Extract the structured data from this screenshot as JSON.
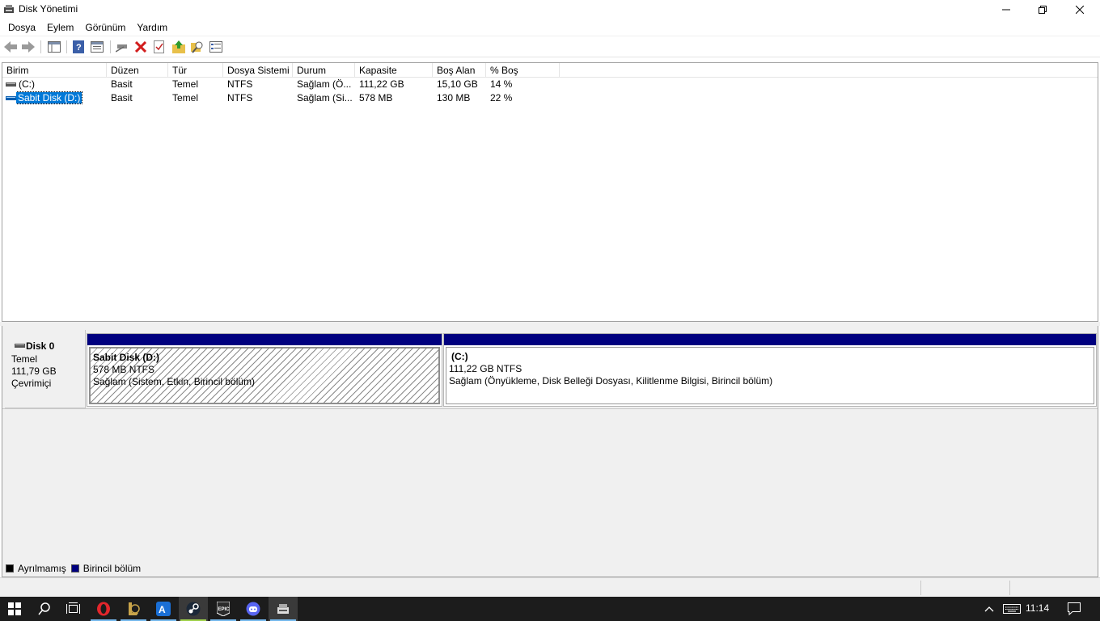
{
  "window": {
    "title": "Disk Yönetimi",
    "icon": "disk-management-icon"
  },
  "menu": {
    "items": [
      "Dosya",
      "Eylem",
      "Görünüm",
      "Yardım"
    ]
  },
  "toolbar": {
    "icons": [
      "back-arrow-icon",
      "forward-arrow-icon",
      "console-tree-icon",
      "help-icon",
      "properties-icon",
      "connect-disk-icon",
      "delete-icon",
      "check-icon",
      "up-folder-icon",
      "search-icon",
      "settings-list-icon"
    ]
  },
  "volume_list": {
    "columns": [
      "Birim",
      "Düzen",
      "Tür",
      "Dosya Sistemi",
      "Durum",
      "Kapasite",
      "Boş Alan",
      "% Boş"
    ],
    "rows": [
      {
        "birim": " (C:)",
        "duzen": "Basit",
        "tur": "Temel",
        "dosya_sistemi": "NTFS",
        "durum": "Sağlam (Ö...",
        "kapasite": "111,22 GB",
        "bos_alan": "15,10 GB",
        "yuzde_bos": "14 %",
        "selected": false
      },
      {
        "birim": "Sabit Disk (D:)",
        "duzen": "Basit",
        "tur": "Temel",
        "dosya_sistemi": "NTFS",
        "durum": "Sağlam (Si...",
        "kapasite": "578 MB",
        "bos_alan": "130 MB",
        "yuzde_bos": "22 %",
        "selected": true
      }
    ]
  },
  "disk": {
    "name": "Disk 0",
    "type": "Temel",
    "size": "111,79 GB",
    "status": "Çevrimiçi"
  },
  "partitions": [
    {
      "title": "Sabit Disk  (D:)",
      "size": "578 MB NTFS",
      "status": "Sağlam (Sistem, Etkin, Birincil bölüm)",
      "selected": true
    },
    {
      "title": "(C:)",
      "size": "111,22 GB NTFS",
      "status": "Sağlam (Önyükleme, Disk Belleği Dosyası, Kilitlenme Bilgisi, Birincil bölüm)",
      "selected": false
    }
  ],
  "legend": {
    "unallocated": {
      "label": "Ayrılmamış",
      "color": "#000000"
    },
    "primary": {
      "label": "Birincil bölüm",
      "color": "#00007f"
    }
  },
  "taskbar": {
    "apps": [
      "windows-start-icon",
      "search-icon",
      "task-view-icon",
      "opera-icon",
      "league-icon",
      "app-a-icon",
      "steam-icon",
      "epic-games-icon",
      "discord-icon",
      "disk-management-icon"
    ],
    "clock": "11:14"
  },
  "colors": {
    "partition_bar": "#00007f",
    "selection": "#0078d7"
  }
}
